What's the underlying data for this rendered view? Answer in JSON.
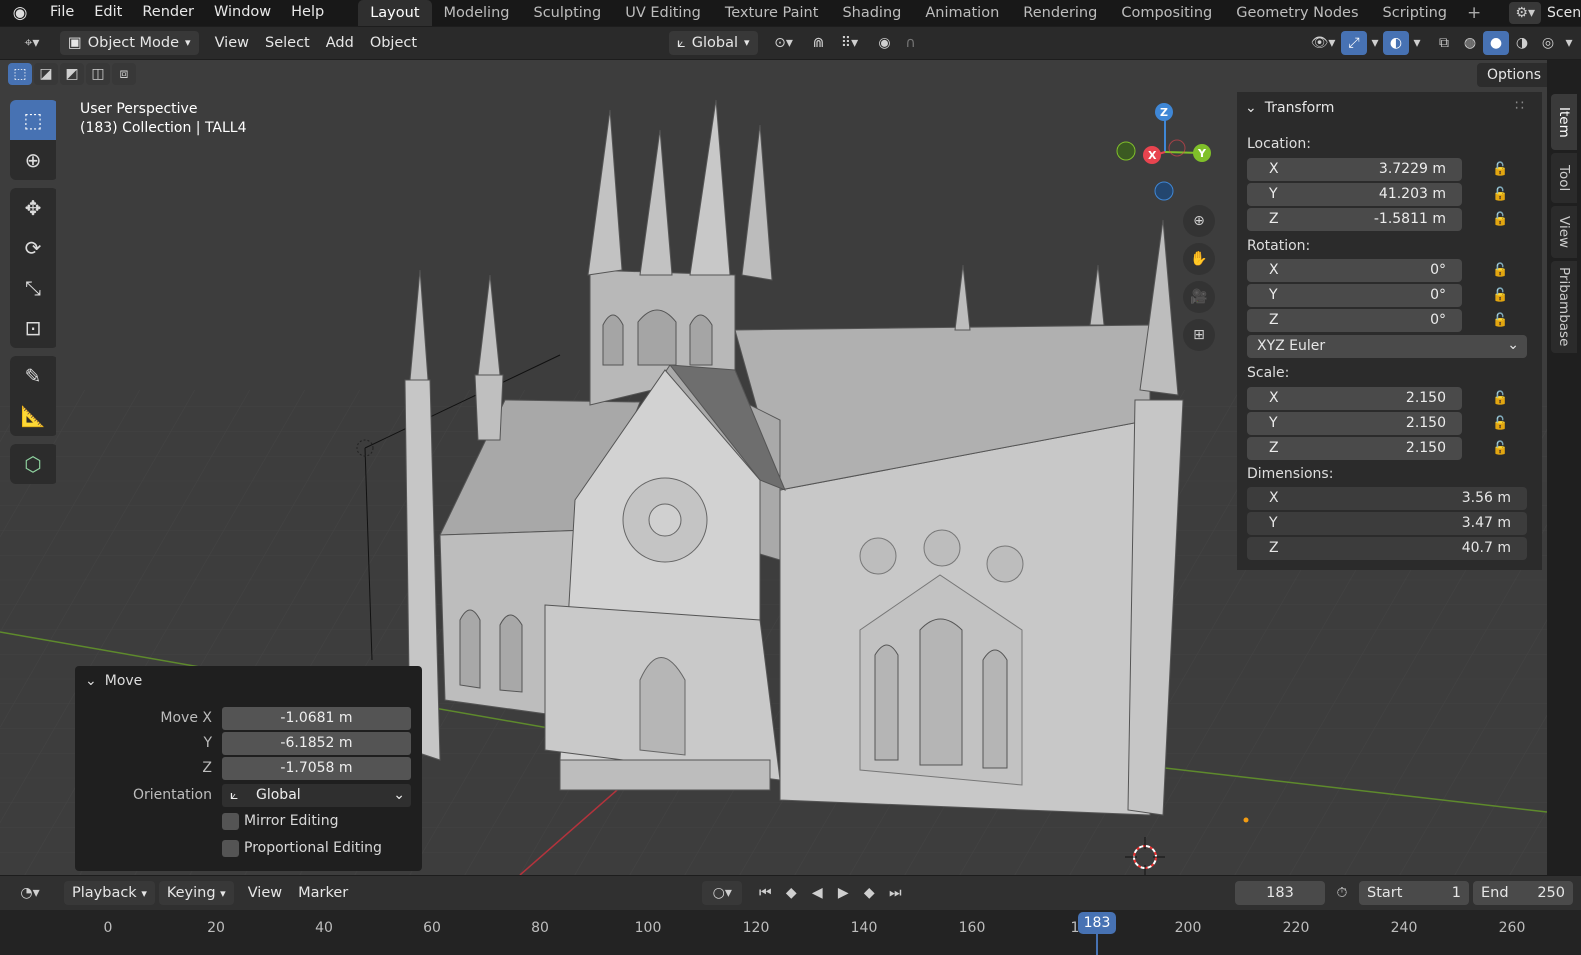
{
  "menu": {
    "items": [
      "File",
      "Edit",
      "Render",
      "Window",
      "Help"
    ]
  },
  "workspaces": {
    "tabs": [
      "Layout",
      "Modeling",
      "Sculpting",
      "UV Editing",
      "Texture Paint",
      "Shading",
      "Animation",
      "Rendering",
      "Compositing",
      "Geometry Nodes",
      "Scripting"
    ],
    "active": "Layout",
    "scene_label": "Scen"
  },
  "header": {
    "mode": "Object Mode",
    "view": "View",
    "select": "Select",
    "add": "Add",
    "object": "Object",
    "orientation": "Global",
    "options": "Options"
  },
  "viewport": {
    "perspective": "User Perspective",
    "collection": "(183) Collection | TALL4"
  },
  "gizmo": {
    "x": "X",
    "y": "Y",
    "z": "Z"
  },
  "npanel": {
    "title": "Transform",
    "location_label": "Location:",
    "location": [
      {
        "axis": "X",
        "value": "3.7229 m"
      },
      {
        "axis": "Y",
        "value": "41.203 m"
      },
      {
        "axis": "Z",
        "value": "-1.5811 m"
      }
    ],
    "rotation_label": "Rotation:",
    "rotation": [
      {
        "axis": "X",
        "value": "0°"
      },
      {
        "axis": "Y",
        "value": "0°"
      },
      {
        "axis": "Z",
        "value": "0°"
      }
    ],
    "rotation_mode": "XYZ Euler",
    "scale_label": "Scale:",
    "scale": [
      {
        "axis": "X",
        "value": "2.150"
      },
      {
        "axis": "Y",
        "value": "2.150"
      },
      {
        "axis": "Z",
        "value": "2.150"
      }
    ],
    "dimensions_label": "Dimensions:",
    "dimensions": [
      {
        "axis": "X",
        "value": "3.56 m"
      },
      {
        "axis": "Y",
        "value": "3.47 m"
      },
      {
        "axis": "Z",
        "value": "40.7 m"
      }
    ]
  },
  "sidetabs": [
    "Item",
    "Tool",
    "View",
    "Pribambase"
  ],
  "move_panel": {
    "title": "Move",
    "move_x_label": "Move X",
    "move_x": "-1.0681 m",
    "y_label": "Y",
    "move_y": "-6.1852 m",
    "z_label": "Z",
    "move_z": "-1.7058 m",
    "orientation_label": "Orientation",
    "orientation": "Global",
    "mirror": "Mirror Editing",
    "proportional": "Proportional Editing"
  },
  "timeline": {
    "playback": "Playback",
    "keying": "Keying",
    "view": "View",
    "marker": "Marker",
    "current_frame": "183",
    "start_label": "Start",
    "start": "1",
    "end_label": "End",
    "end": "250",
    "ticks": [
      "0",
      "20",
      "40",
      "60",
      "80",
      "100",
      "120",
      "140",
      "160",
      "1",
      "200",
      "220",
      "240",
      "260"
    ],
    "playhead": "183"
  },
  "colors": {
    "accent": "#4772b3",
    "x_axis": "#e8444f",
    "y_axis": "#80c02a",
    "z_axis": "#3f87d6"
  }
}
